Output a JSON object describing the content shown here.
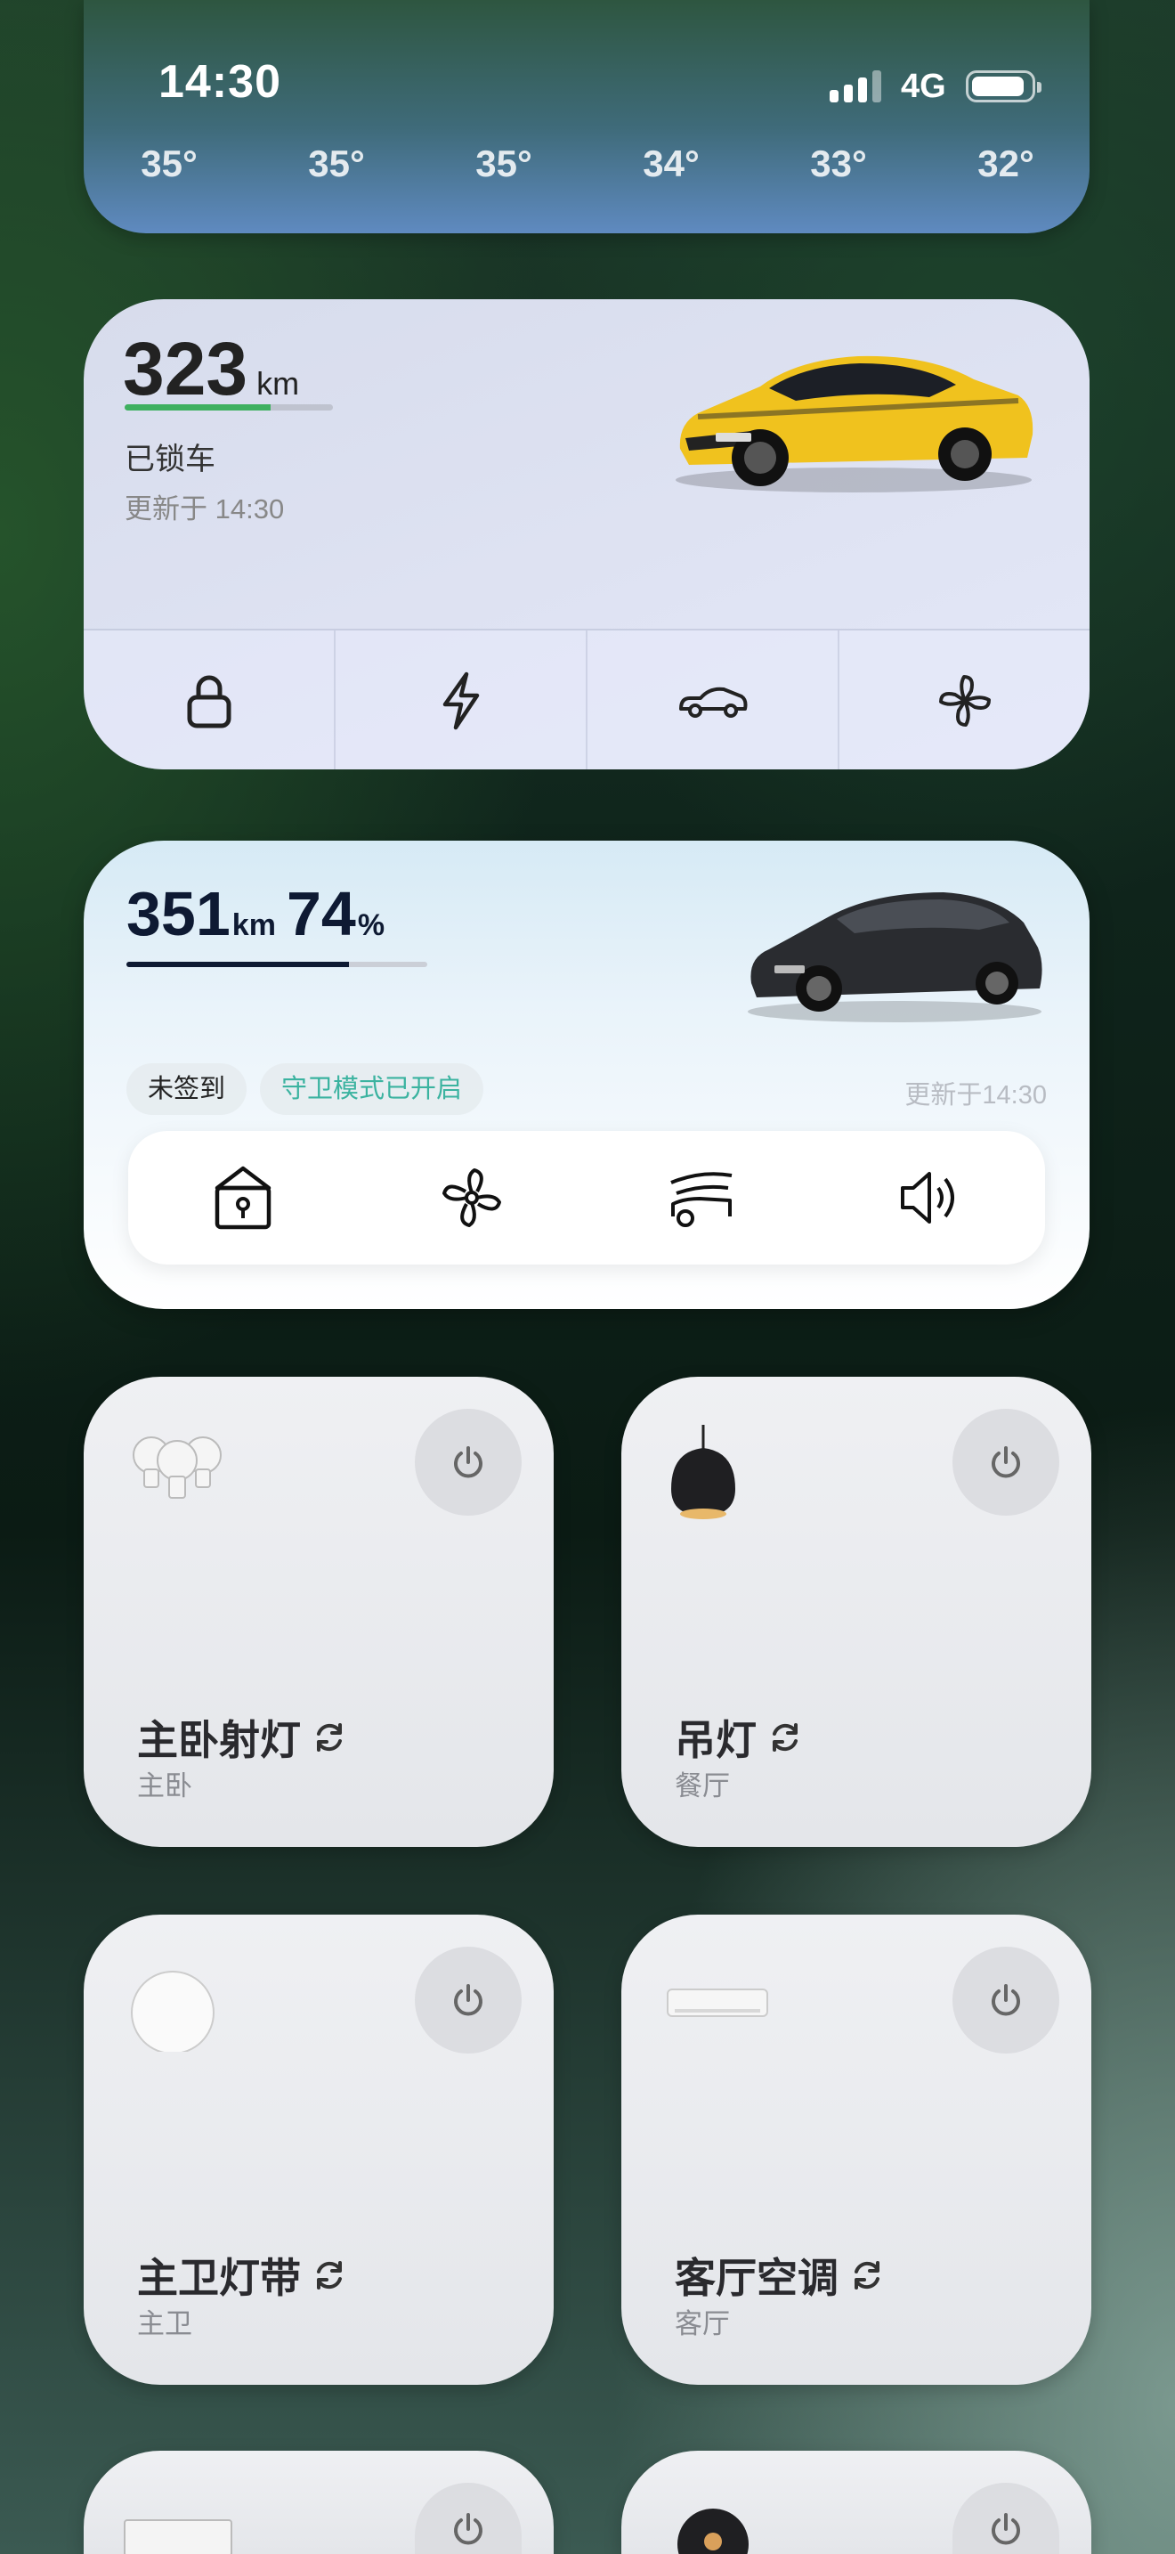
{
  "status_bar": {
    "time": "14:30",
    "network": "4G"
  },
  "weather": {
    "temps": [
      "35°",
      "35°",
      "35°",
      "34°",
      "33°",
      "32°"
    ]
  },
  "car1": {
    "range_value": "323",
    "range_unit": "km",
    "range_fraction": 0.7,
    "lock_status": "已锁车",
    "updated": "更新于 14:30",
    "actions": [
      "lock-icon",
      "charge-icon",
      "car-icon",
      "fan-icon"
    ],
    "color": "#f0c21e"
  },
  "car2": {
    "range_value": "351",
    "range_unit": "km",
    "battery_value": "74",
    "battery_unit": "%",
    "battery_fraction": 0.74,
    "tag_checkin": "未签到",
    "tag_guard": "守卫模式已开启",
    "updated": "更新于14:30",
    "actions": [
      "unlock-icon",
      "fan-icon",
      "trunk-icon",
      "speaker-icon"
    ],
    "color": "#2a2c30"
  },
  "devices": [
    {
      "name": "主卧射灯",
      "room": "主卧",
      "icon": "bulbs-icon"
    },
    {
      "name": "吊灯",
      "room": "餐厅",
      "icon": "pendant-lamp-icon"
    },
    {
      "name": "主卫灯带",
      "room": "主卫",
      "icon": "light-strip-icon"
    },
    {
      "name": "客厅空调",
      "room": "客厅",
      "icon": "air-conditioner-icon"
    }
  ]
}
